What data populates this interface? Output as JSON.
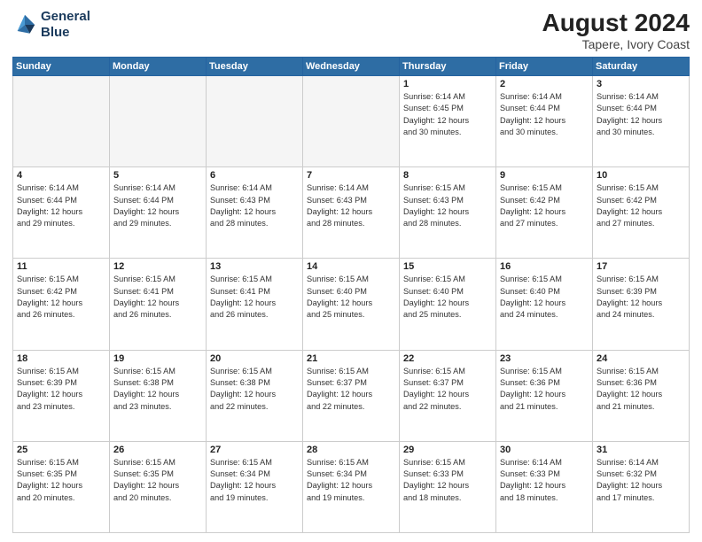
{
  "header": {
    "logo_line1": "General",
    "logo_line2": "Blue",
    "month_year": "August 2024",
    "location": "Tapere, Ivory Coast"
  },
  "days_of_week": [
    "Sunday",
    "Monday",
    "Tuesday",
    "Wednesday",
    "Thursday",
    "Friday",
    "Saturday"
  ],
  "weeks": [
    [
      {
        "num": "",
        "info": ""
      },
      {
        "num": "",
        "info": ""
      },
      {
        "num": "",
        "info": ""
      },
      {
        "num": "",
        "info": ""
      },
      {
        "num": "1",
        "info": "Sunrise: 6:14 AM\nSunset: 6:45 PM\nDaylight: 12 hours\nand 30 minutes."
      },
      {
        "num": "2",
        "info": "Sunrise: 6:14 AM\nSunset: 6:44 PM\nDaylight: 12 hours\nand 30 minutes."
      },
      {
        "num": "3",
        "info": "Sunrise: 6:14 AM\nSunset: 6:44 PM\nDaylight: 12 hours\nand 30 minutes."
      }
    ],
    [
      {
        "num": "4",
        "info": "Sunrise: 6:14 AM\nSunset: 6:44 PM\nDaylight: 12 hours\nand 29 minutes."
      },
      {
        "num": "5",
        "info": "Sunrise: 6:14 AM\nSunset: 6:44 PM\nDaylight: 12 hours\nand 29 minutes."
      },
      {
        "num": "6",
        "info": "Sunrise: 6:14 AM\nSunset: 6:43 PM\nDaylight: 12 hours\nand 28 minutes."
      },
      {
        "num": "7",
        "info": "Sunrise: 6:14 AM\nSunset: 6:43 PM\nDaylight: 12 hours\nand 28 minutes."
      },
      {
        "num": "8",
        "info": "Sunrise: 6:15 AM\nSunset: 6:43 PM\nDaylight: 12 hours\nand 28 minutes."
      },
      {
        "num": "9",
        "info": "Sunrise: 6:15 AM\nSunset: 6:42 PM\nDaylight: 12 hours\nand 27 minutes."
      },
      {
        "num": "10",
        "info": "Sunrise: 6:15 AM\nSunset: 6:42 PM\nDaylight: 12 hours\nand 27 minutes."
      }
    ],
    [
      {
        "num": "11",
        "info": "Sunrise: 6:15 AM\nSunset: 6:42 PM\nDaylight: 12 hours\nand 26 minutes."
      },
      {
        "num": "12",
        "info": "Sunrise: 6:15 AM\nSunset: 6:41 PM\nDaylight: 12 hours\nand 26 minutes."
      },
      {
        "num": "13",
        "info": "Sunrise: 6:15 AM\nSunset: 6:41 PM\nDaylight: 12 hours\nand 26 minutes."
      },
      {
        "num": "14",
        "info": "Sunrise: 6:15 AM\nSunset: 6:40 PM\nDaylight: 12 hours\nand 25 minutes."
      },
      {
        "num": "15",
        "info": "Sunrise: 6:15 AM\nSunset: 6:40 PM\nDaylight: 12 hours\nand 25 minutes."
      },
      {
        "num": "16",
        "info": "Sunrise: 6:15 AM\nSunset: 6:40 PM\nDaylight: 12 hours\nand 24 minutes."
      },
      {
        "num": "17",
        "info": "Sunrise: 6:15 AM\nSunset: 6:39 PM\nDaylight: 12 hours\nand 24 minutes."
      }
    ],
    [
      {
        "num": "18",
        "info": "Sunrise: 6:15 AM\nSunset: 6:39 PM\nDaylight: 12 hours\nand 23 minutes."
      },
      {
        "num": "19",
        "info": "Sunrise: 6:15 AM\nSunset: 6:38 PM\nDaylight: 12 hours\nand 23 minutes."
      },
      {
        "num": "20",
        "info": "Sunrise: 6:15 AM\nSunset: 6:38 PM\nDaylight: 12 hours\nand 22 minutes."
      },
      {
        "num": "21",
        "info": "Sunrise: 6:15 AM\nSunset: 6:37 PM\nDaylight: 12 hours\nand 22 minutes."
      },
      {
        "num": "22",
        "info": "Sunrise: 6:15 AM\nSunset: 6:37 PM\nDaylight: 12 hours\nand 22 minutes."
      },
      {
        "num": "23",
        "info": "Sunrise: 6:15 AM\nSunset: 6:36 PM\nDaylight: 12 hours\nand 21 minutes."
      },
      {
        "num": "24",
        "info": "Sunrise: 6:15 AM\nSunset: 6:36 PM\nDaylight: 12 hours\nand 21 minutes."
      }
    ],
    [
      {
        "num": "25",
        "info": "Sunrise: 6:15 AM\nSunset: 6:35 PM\nDaylight: 12 hours\nand 20 minutes."
      },
      {
        "num": "26",
        "info": "Sunrise: 6:15 AM\nSunset: 6:35 PM\nDaylight: 12 hours\nand 20 minutes."
      },
      {
        "num": "27",
        "info": "Sunrise: 6:15 AM\nSunset: 6:34 PM\nDaylight: 12 hours\nand 19 minutes."
      },
      {
        "num": "28",
        "info": "Sunrise: 6:15 AM\nSunset: 6:34 PM\nDaylight: 12 hours\nand 19 minutes."
      },
      {
        "num": "29",
        "info": "Sunrise: 6:15 AM\nSunset: 6:33 PM\nDaylight: 12 hours\nand 18 minutes."
      },
      {
        "num": "30",
        "info": "Sunrise: 6:14 AM\nSunset: 6:33 PM\nDaylight: 12 hours\nand 18 minutes."
      },
      {
        "num": "31",
        "info": "Sunrise: 6:14 AM\nSunset: 6:32 PM\nDaylight: 12 hours\nand 17 minutes."
      }
    ]
  ]
}
